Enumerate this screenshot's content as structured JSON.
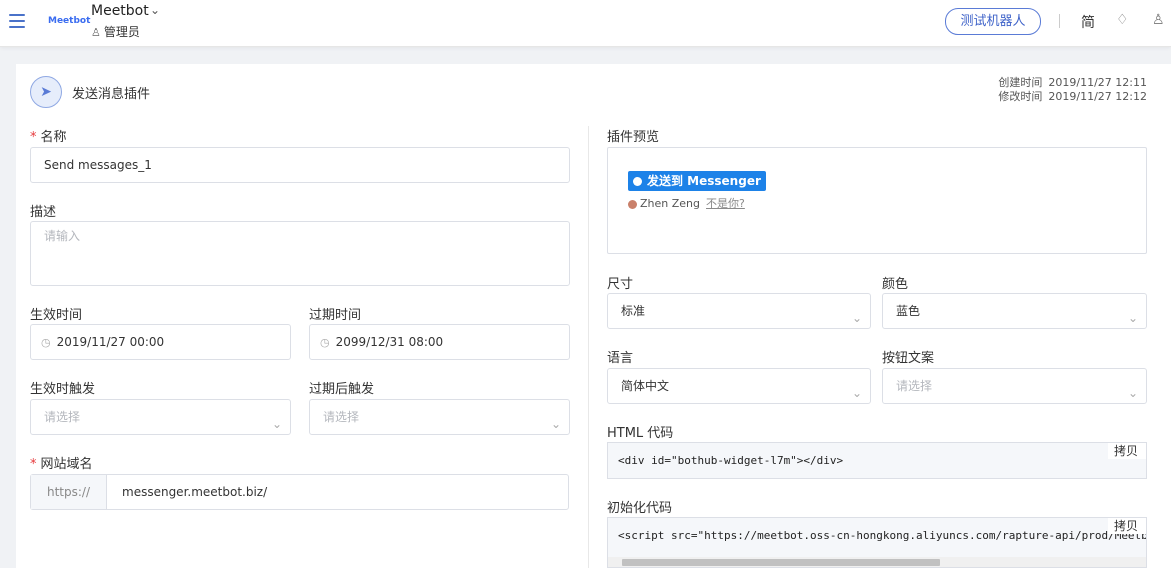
{
  "header": {
    "logo": "Meetbot",
    "app_name": "Meetbot",
    "role": "管理员",
    "test_button": "测试机器人",
    "language": "简"
  },
  "plugin": {
    "title": "发送消息插件",
    "created_label": "创建时间",
    "created_value": "2019/11/27 12:11",
    "modified_label": "修改时间",
    "modified_value": "2019/11/27 12:12"
  },
  "form": {
    "name_label": "名称",
    "name_value": "Send messages_1",
    "desc_label": "描述",
    "desc_placeholder": "请输入",
    "start_label": "生效时间",
    "start_value": "2019/11/27 00:00",
    "end_label": "过期时间",
    "end_value": "2099/12/31 08:00",
    "start_trigger_label": "生效时触发",
    "start_trigger_placeholder": "请选择",
    "end_trigger_label": "过期后触发",
    "end_trigger_placeholder": "请选择",
    "domain_label": "网站域名",
    "domain_prefix": "https://",
    "domain_value": "messenger.meetbot.biz/"
  },
  "right": {
    "preview_label": "插件预览",
    "preview_button": "发送到 Messenger",
    "preview_user": "Zhen Zeng",
    "preview_not_you": "不是你?",
    "size_label": "尺寸",
    "size_value": "标准",
    "color_label": "颜色",
    "color_value": "蓝色",
    "lang_label": "语言",
    "lang_value": "简体中文",
    "btn_text_label": "按钮文案",
    "btn_text_placeholder": "请选择",
    "html_label": "HTML 代码",
    "html_code": "<div id=\"bothub-widget-l7m\"></div>",
    "copy_label": "拷贝",
    "init_label": "初始化代码",
    "init_code": "<script src=\"https://meetbot.oss-cn-hongkong.aliyuncs.com/rapture-api/prod/Meetbot"
  },
  "colors": {
    "accent": "#3f63c9",
    "messenger": "#1d82e8",
    "required": "#e6393c"
  }
}
